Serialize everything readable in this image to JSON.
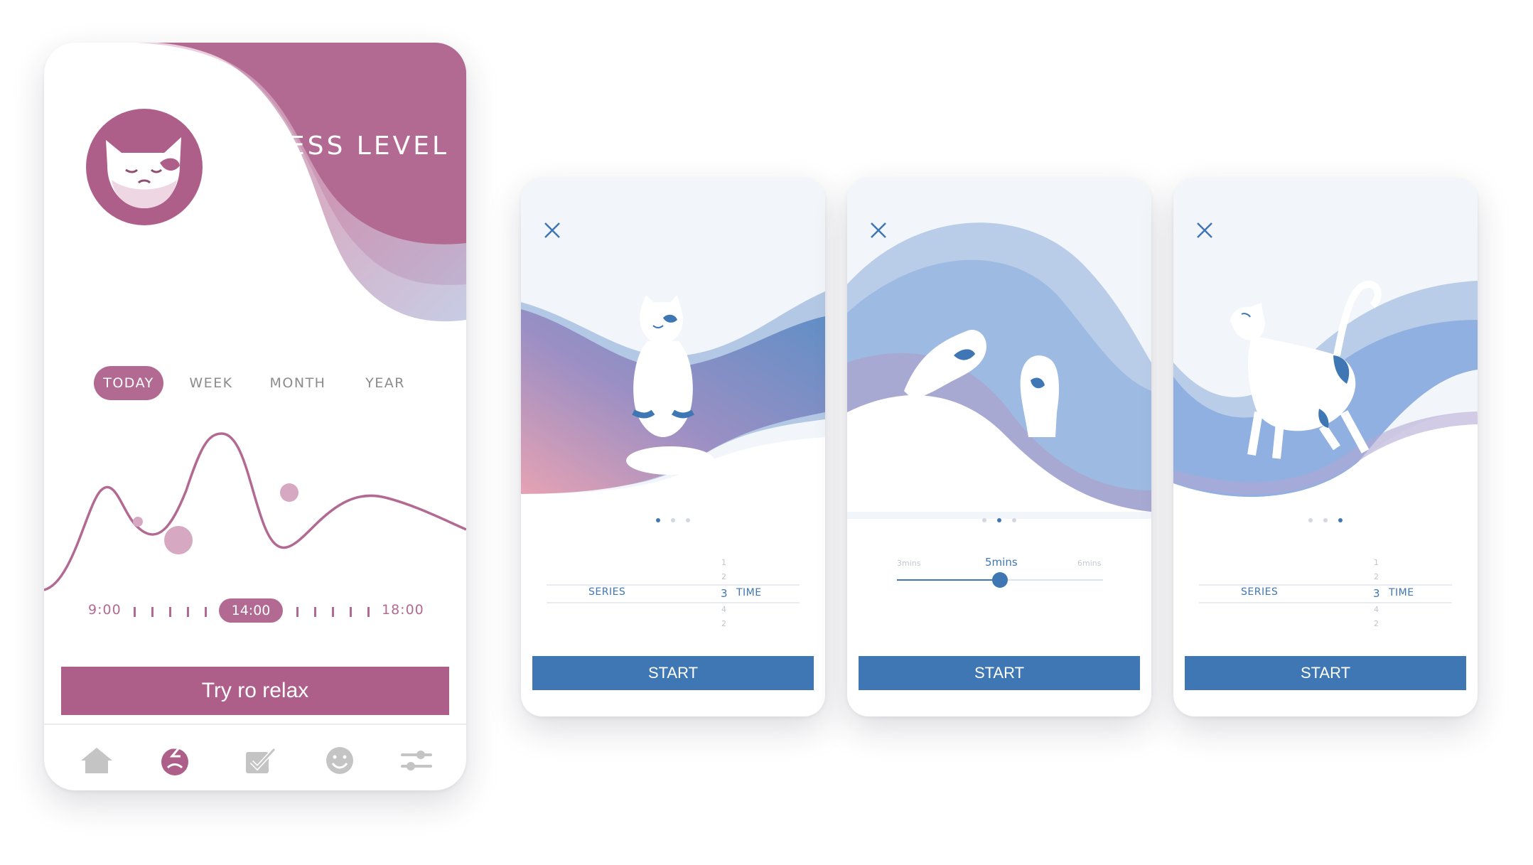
{
  "colors": {
    "brand_pink": "#b26a92",
    "brand_blue": "#3e77b4",
    "muted": "#8c8c8c"
  },
  "stress_screen": {
    "title": "STRESS LEVEL",
    "avatar_icon": "cat-face-icon",
    "tabs": [
      {
        "label": "TODAY",
        "active": true
      },
      {
        "label": "WEEK",
        "active": false
      },
      {
        "label": "MONTH",
        "active": false
      },
      {
        "label": "YEAR",
        "active": false
      }
    ],
    "timeline": {
      "start": "9:00",
      "current": "14:00",
      "end": "18:00"
    },
    "cta_label": "Try ro relax",
    "nav_icons": [
      "home-icon",
      "stress-icon",
      "tasks-icon",
      "smiley-icon",
      "settings-icon"
    ]
  },
  "exercise_cards": [
    {
      "illustration": "meditating-cat",
      "active_dot": 0,
      "picker": {
        "left_label": "SERIES",
        "value": "3",
        "right_label": "TIME",
        "above": [
          "1",
          "2"
        ],
        "below": [
          "4",
          "2"
        ]
      },
      "start_label": "START"
    },
    {
      "illustration": "cat-paws",
      "active_dot": 1,
      "slider": {
        "min_label": "3mins",
        "value_label": "5mins",
        "max_label": "6mins",
        "position": 0.5
      },
      "start_label": "START"
    },
    {
      "illustration": "stretching-cat",
      "active_dot": 2,
      "picker": {
        "left_label": "SERIES",
        "value": "3",
        "right_label": "TIME",
        "above": [
          "1",
          "2"
        ],
        "below": [
          "4",
          "2"
        ]
      },
      "start_label": "START"
    }
  ]
}
